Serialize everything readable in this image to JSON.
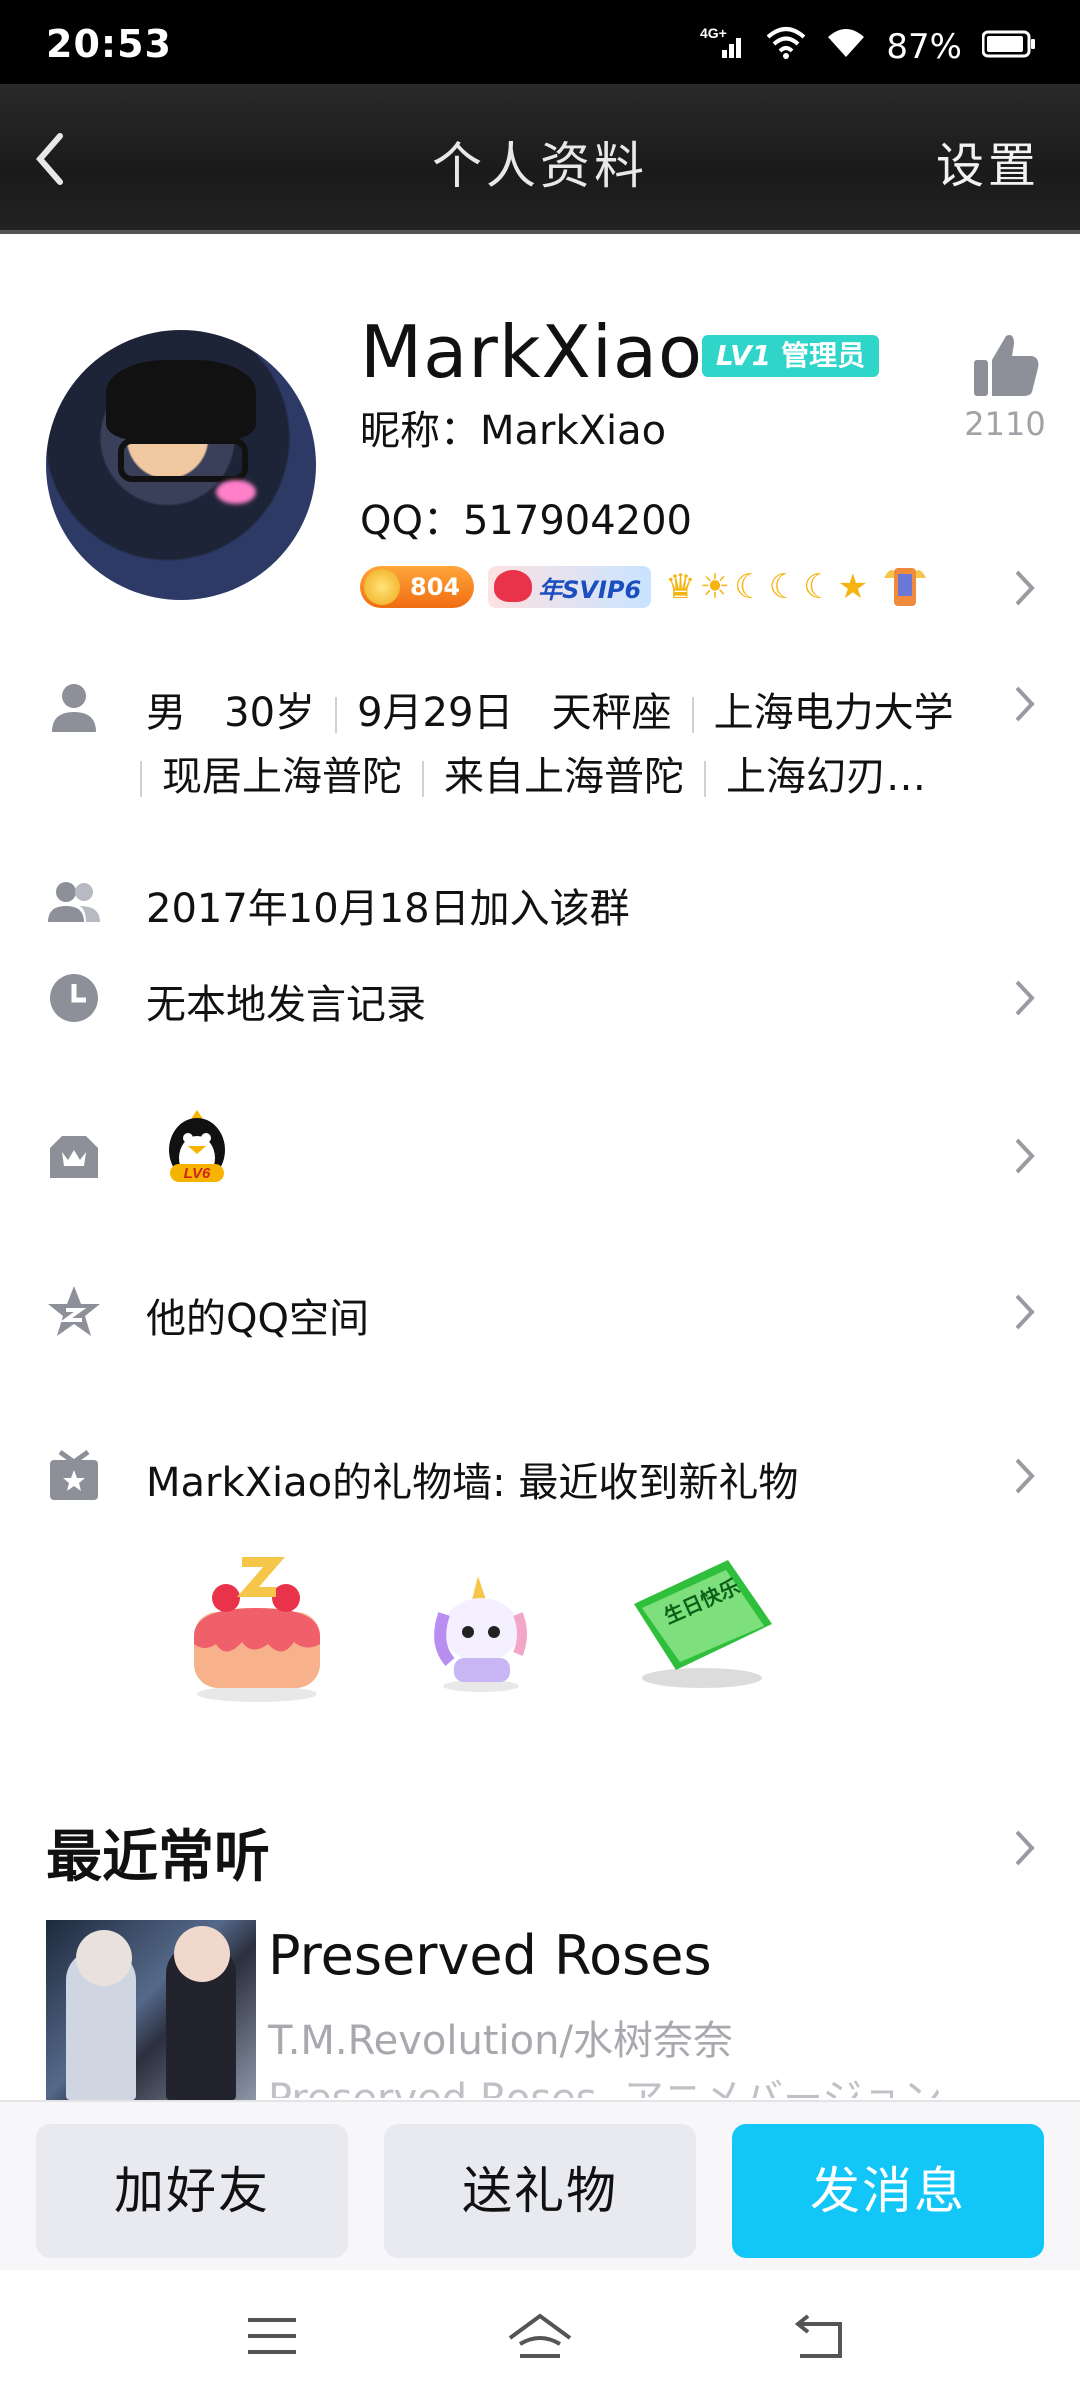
{
  "status_bar": {
    "time": "20:53",
    "network": "4G+",
    "battery": "87%"
  },
  "title_bar": {
    "title": "个人资料",
    "settings_label": "设置"
  },
  "profile": {
    "name": "MarkXiao",
    "level_badge": "LV1",
    "role_badge": "管理员",
    "nickname_line": "昵称：MarkXiao",
    "qq_line": "QQ：517904200",
    "like_count": "2110",
    "coin_badge_value": "804",
    "svip_badge": "年SVIP6"
  },
  "info": {
    "gender": "男",
    "age": "30岁",
    "birthday": "9月29日",
    "zodiac": "天秤座",
    "school": "上海电力大学",
    "residence": "现居上海普陀",
    "hometown": "来自上海普陀",
    "company": "上海幻刃…"
  },
  "rows": {
    "join_date": "2017年10月18日加入该群",
    "speech_record": "无本地发言记录",
    "qzone": "他的QQ空间",
    "gift_wall": "MarkXiao的礼物墙: 最近收到新礼物"
  },
  "gift_items": [
    "cake-gift",
    "unicorn-gift",
    "birthday-card-gift"
  ],
  "gift_card_text": "生日快乐",
  "penguin_level": "LV6",
  "music": {
    "section_title": "最近常听",
    "song_title": "Preserved Roses",
    "artist": "T.M.Revolution/水树奈奈",
    "album": "Preserved Roses -アニメバージョン-"
  },
  "actions": {
    "add_friend": "加好友",
    "send_gift": "送礼物",
    "send_message": "发消息"
  },
  "colors": {
    "accent": "#12c6f7",
    "level_badge": "#2fd5c8",
    "icon_gray": "#8e9099"
  }
}
